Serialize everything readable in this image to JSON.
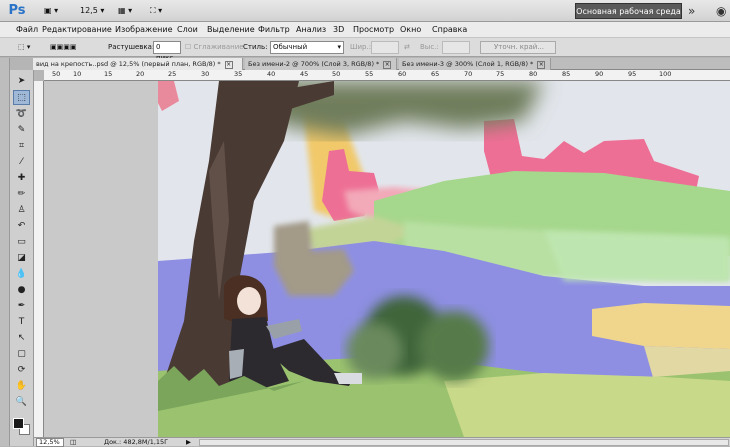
{
  "app": {
    "logo": "Ps",
    "zoom_value": "12,5",
    "workspace_label": "Основная рабочая среда",
    "more_glyph": "»"
  },
  "menu": [
    "Файл",
    "Редактирование",
    "Изображение",
    "Слои",
    "Выделение",
    "Фильтр",
    "Анализ",
    "3D",
    "Просмотр",
    "Окно",
    "Справка"
  ],
  "options": {
    "feather_label": "Растушевка:",
    "feather_value": "0 пикс.",
    "antialias_label": "Сглаживание",
    "style_label": "Стиль:",
    "style_value": "Обычный",
    "width_label": "Шир.:",
    "height_label": "Выс.:",
    "refine_edge_label": "Уточн. край..."
  },
  "tabs": [
    {
      "label": "вид на крепость..psd @ 12,5% (первый план, RGB/8) *"
    },
    {
      "label": "Без имени-2 @ 700% (Слой 3, RGB/8) *"
    },
    {
      "label": "Без имени-3 @ 300% (Слой 1, RGB/8) *"
    }
  ],
  "ruler_top": [
    "50",
    "10",
    "15",
    "20",
    "25",
    "30",
    "35",
    "40",
    "45",
    "50",
    "55",
    "60",
    "65",
    "70",
    "75",
    "80",
    "85",
    "90",
    "95",
    "100"
  ],
  "status": {
    "zoom": "12,5%",
    "doc": "Док.: 482,8M/1,15Г"
  },
  "colors": {
    "workspace_bg": "#5a5a5a",
    "foreground_swatch": "#1a1a1a",
    "background_swatch": "#ffffff"
  }
}
